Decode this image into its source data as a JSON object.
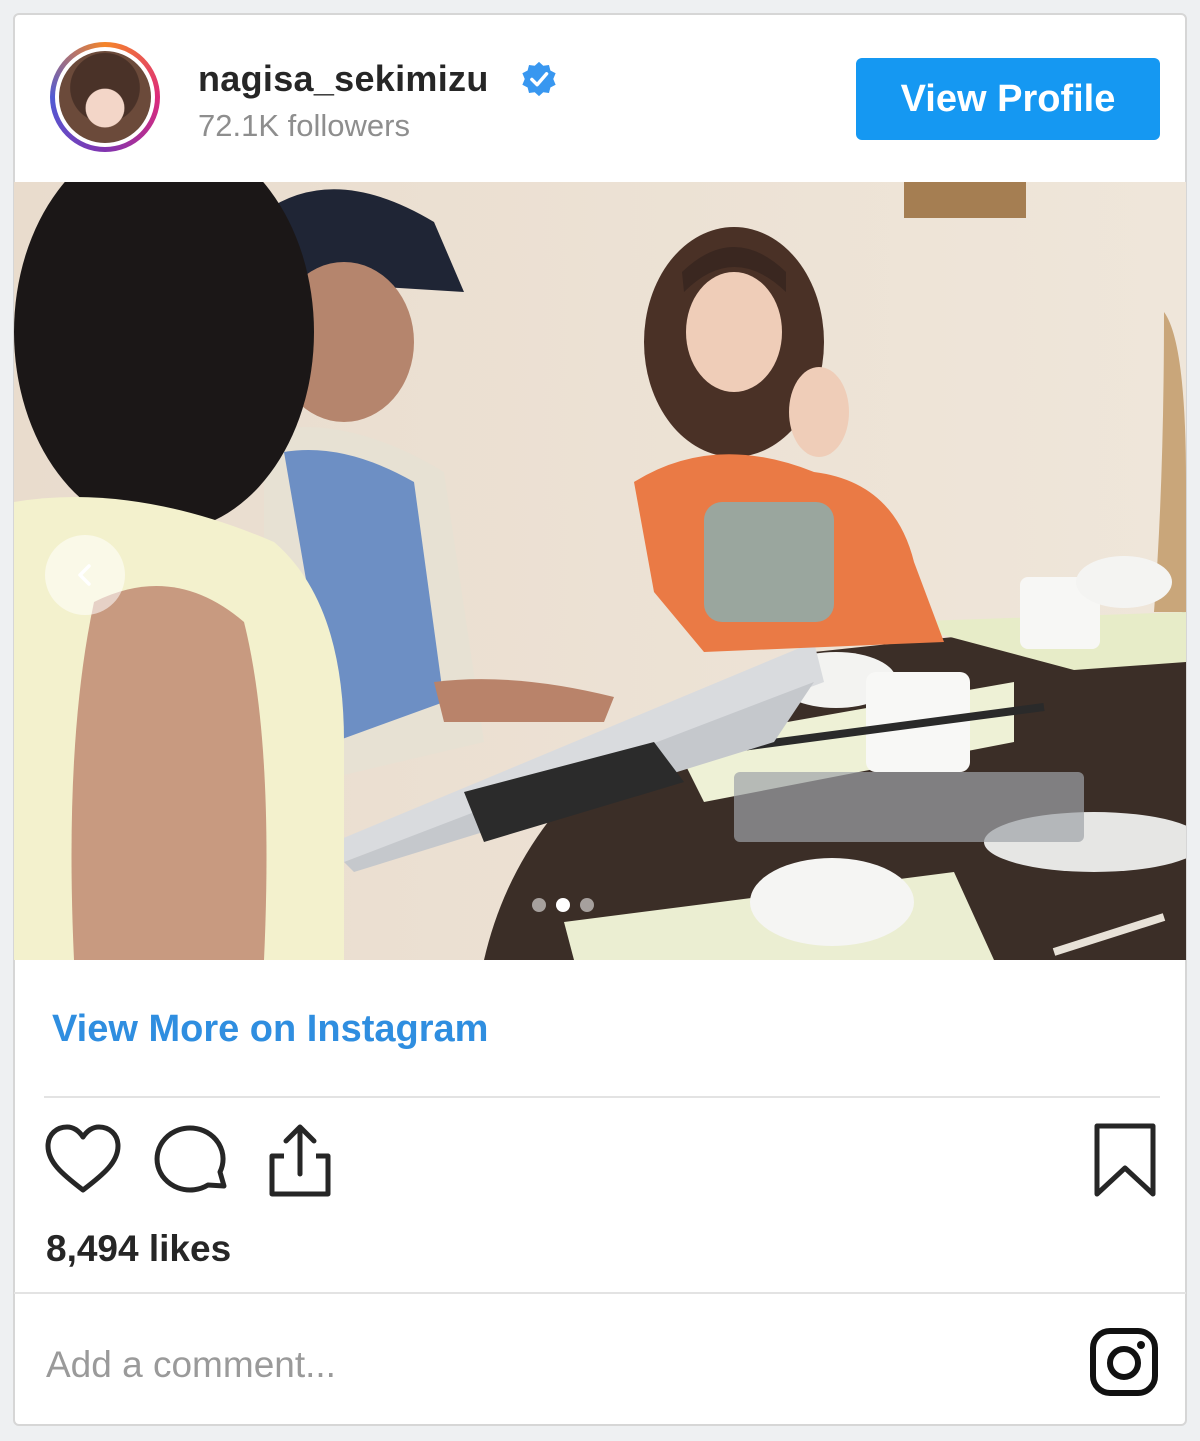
{
  "header": {
    "username": "nagisa_sekimizu",
    "verified": true,
    "followers": "72.1K followers",
    "view_profile_label": "View Profile"
  },
  "post": {
    "image_count": 3,
    "current_index": 1,
    "view_more_label": "View More on Instagram",
    "likes": "8,494 likes",
    "comment_placeholder": "Add a comment..."
  },
  "icons": [
    "avatar",
    "verified-badge-icon",
    "chevron-left-icon",
    "heart-icon",
    "comment-icon",
    "share-icon",
    "bookmark-icon",
    "instagram-icon"
  ],
  "colors": {
    "accent": "#1598f2",
    "link": "#2f8ee0",
    "verified": "#3897f0"
  }
}
